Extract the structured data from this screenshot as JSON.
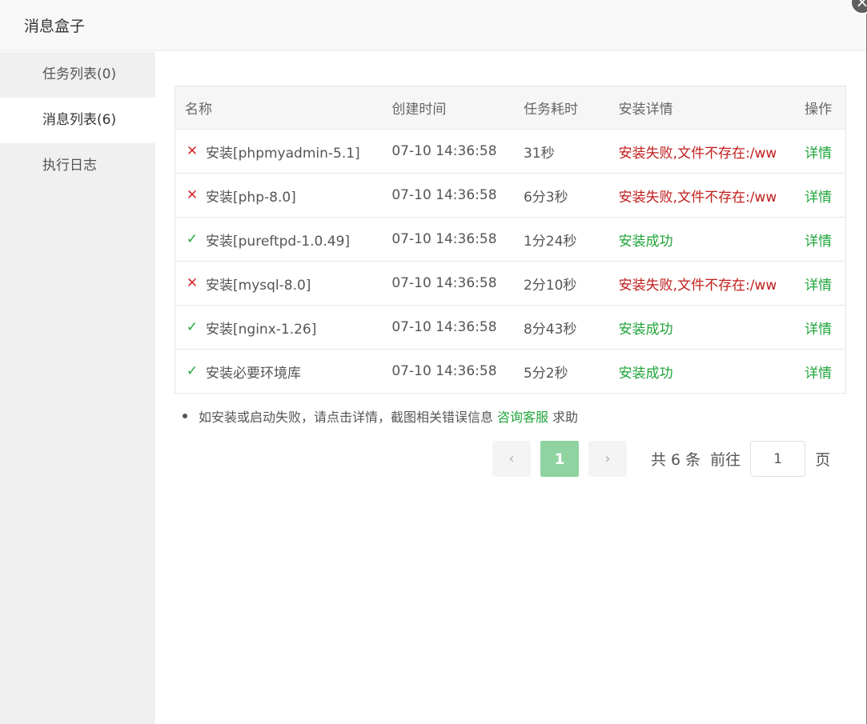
{
  "dialog": {
    "title": "消息盒子",
    "close_icon": "×"
  },
  "sidebar": {
    "items": [
      {
        "label": "任务列表(0)",
        "active": false
      },
      {
        "label": "消息列表(6)",
        "active": true
      },
      {
        "label": "执行日志",
        "active": false
      }
    ]
  },
  "table": {
    "headers": {
      "name": "名称",
      "time": "创建时间",
      "duration": "任务耗时",
      "detail": "安装详情",
      "action": "操作"
    },
    "rows": [
      {
        "status": "fail",
        "icon": "✕",
        "name": "安装[phpmyadmin-5.1]",
        "time": "07-10 14:36:58",
        "duration": "31秒",
        "detail": "安装失败,文件不存在:/www/",
        "action": "详情"
      },
      {
        "status": "fail",
        "icon": "✕",
        "name": "安装[php-8.0]",
        "time": "07-10 14:36:58",
        "duration": "6分3秒",
        "detail": "安装失败,文件不存在:/www/",
        "action": "详情"
      },
      {
        "status": "ok",
        "icon": "✓",
        "name": "安装[pureftpd-1.0.49]",
        "time": "07-10 14:36:58",
        "duration": "1分24秒",
        "detail": "安装成功",
        "action": "详情"
      },
      {
        "status": "fail",
        "icon": "✕",
        "name": "安装[mysql-8.0]",
        "time": "07-10 14:36:58",
        "duration": "2分10秒",
        "detail": "安装失败,文件不存在:/www/",
        "action": "详情"
      },
      {
        "status": "ok",
        "icon": "✓",
        "name": "安装[nginx-1.26]",
        "time": "07-10 14:36:58",
        "duration": "8分43秒",
        "detail": "安装成功",
        "action": "详情"
      },
      {
        "status": "ok",
        "icon": "✓",
        "name": "安装必要环境库",
        "time": "07-10 14:36:58",
        "duration": "5分2秒",
        "detail": "安装成功",
        "action": "详情"
      }
    ]
  },
  "note": {
    "text": "如安装或启动失败，请点击详情，截图相关错误信息",
    "link": "咨询客服",
    "suffix": "求助"
  },
  "pager": {
    "prev": "‹",
    "current": "1",
    "next": "›",
    "total": "共 6 条",
    "goto": "前往",
    "input_value": "1",
    "page_suffix": "页"
  },
  "colors": {
    "success": "#20a53a",
    "fail": "#c21d1d",
    "pager_active": "#8fd3a0"
  }
}
